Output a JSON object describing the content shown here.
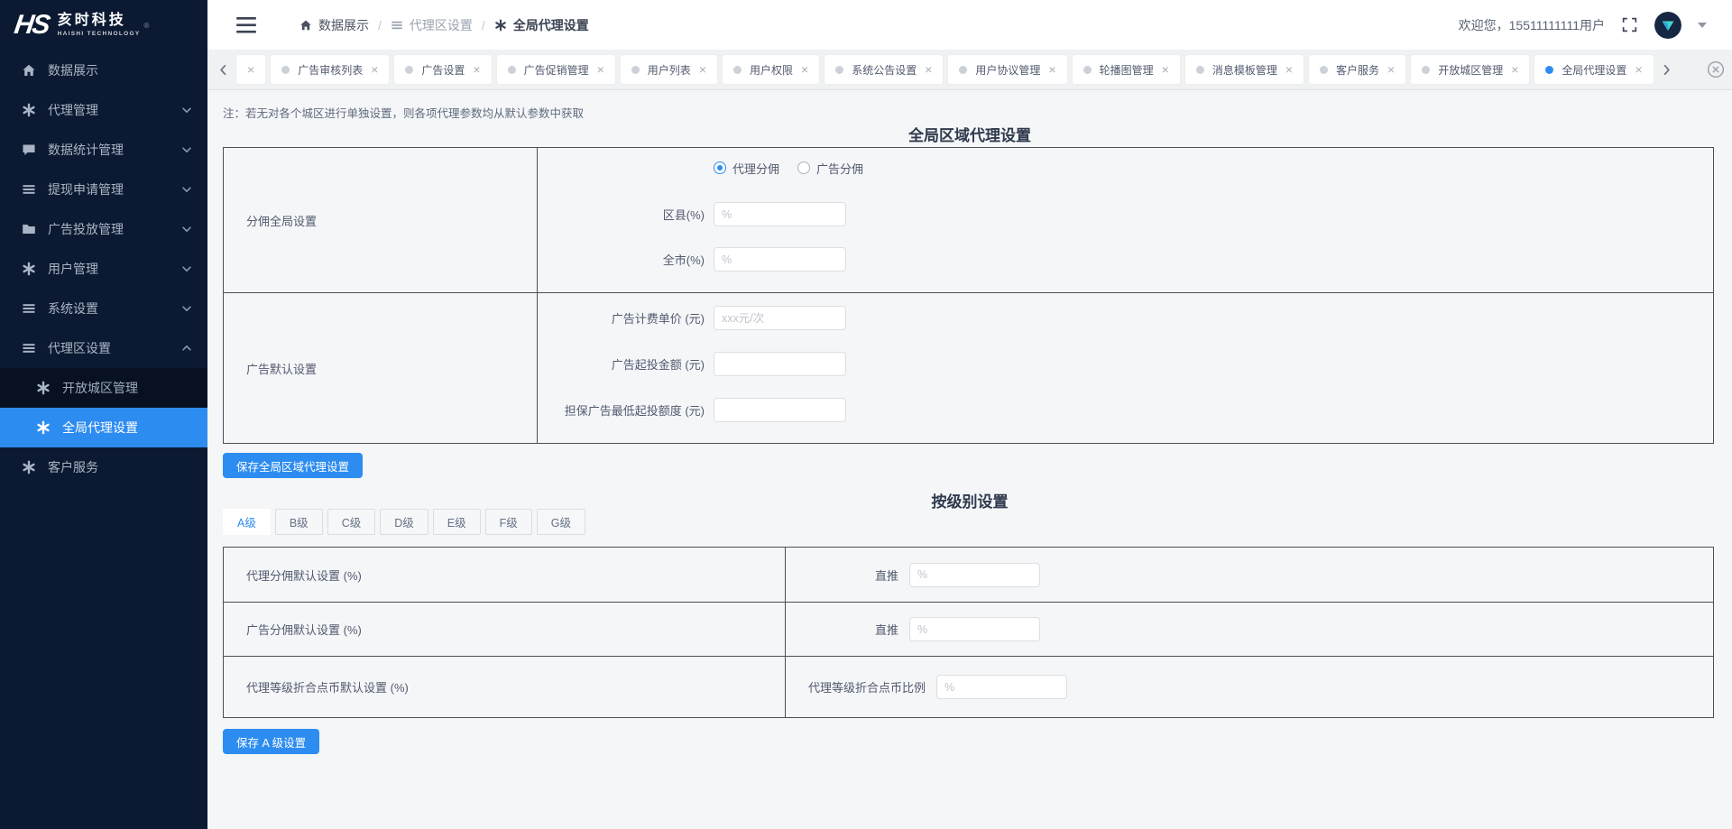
{
  "brand": {
    "monogram": "HS",
    "title": "亥时科技",
    "subtitle": "HAISHI TECHNOLOGY",
    "registered": "®"
  },
  "icons": {
    "close": "×",
    "separator": "/"
  },
  "sidebar": {
    "items": [
      {
        "label": "数据展示"
      },
      {
        "label": "代理管理"
      },
      {
        "label": "数据统计管理"
      },
      {
        "label": "提现申请管理"
      },
      {
        "label": "广告投放管理"
      },
      {
        "label": "用户管理"
      },
      {
        "label": "系统设置"
      },
      {
        "label": "代理区设置",
        "children": [
          {
            "label": "开放城区管理",
            "active": false
          },
          {
            "label": "全局代理设置",
            "active": true
          }
        ]
      },
      {
        "label": "客户服务"
      }
    ]
  },
  "header": {
    "breadcrumb": [
      {
        "label": "数据展示"
      },
      {
        "label": "代理区设置"
      },
      {
        "label": "全局代理设置"
      }
    ],
    "welcome": "欢迎您，15511111111用户"
  },
  "tabbar": {
    "tabs": [
      {
        "label": "广告审核列表"
      },
      {
        "label": "广告设置"
      },
      {
        "label": "广告促销管理"
      },
      {
        "label": "用户列表"
      },
      {
        "label": "用户权限"
      },
      {
        "label": "系统公告设置"
      },
      {
        "label": "用户协议管理"
      },
      {
        "label": "轮播图管理"
      },
      {
        "label": "消息模板管理"
      },
      {
        "label": "客户服务"
      },
      {
        "label": "开放城区管理"
      },
      {
        "label": "全局代理设置",
        "active": true
      }
    ]
  },
  "main": {
    "note": "注：若无对各个城区进行单独设置，则各项代理参数均从默认参数中获取",
    "region_section": {
      "title": "全局区域代理设置",
      "row1_label": "分佣全局设置",
      "row2_label": "广告默认设置",
      "radio_options": [
        {
          "label": "代理分佣",
          "selected": true
        },
        {
          "label": "广告分佣",
          "selected": false
        }
      ],
      "commission_fields": [
        {
          "label": "区县(%)",
          "placeholder": "%"
        },
        {
          "label": "全市(%)",
          "placeholder": "%"
        }
      ],
      "ad_fields": [
        {
          "label": "广告计费单价 (元)",
          "placeholder": "xxx元/次"
        },
        {
          "label": "广告起投金额 (元)",
          "placeholder": ""
        },
        {
          "label": "担保广告最低起投额度 (元)",
          "placeholder": ""
        }
      ],
      "save_label": "保存全局区域代理设置"
    },
    "level_section": {
      "title": "按级别设置",
      "tabs": [
        {
          "label": "A级",
          "active": true
        },
        {
          "label": "B级"
        },
        {
          "label": "C级"
        },
        {
          "label": "D级"
        },
        {
          "label": "E级"
        },
        {
          "label": "F级"
        },
        {
          "label": "G级"
        }
      ],
      "rows": [
        {
          "label": "代理分佣默认设置 (%)",
          "field_label": "直推",
          "placeholder": "%"
        },
        {
          "label": "广告分佣默认设置 (%)",
          "field_label": "直推",
          "placeholder": "%"
        },
        {
          "label": "代理等级折合点币默认设置 (%)",
          "field_label": "代理等级折合点币比例",
          "placeholder": "%"
        }
      ],
      "save_label": "保存 A 级设置"
    }
  },
  "colors": {
    "accent": "#2d8cf0",
    "sidebar_bg": "#0b1a32",
    "submenu_bg": "#071122",
    "content_bg": "#f5f6f8",
    "table_border": "#4a4f59"
  }
}
